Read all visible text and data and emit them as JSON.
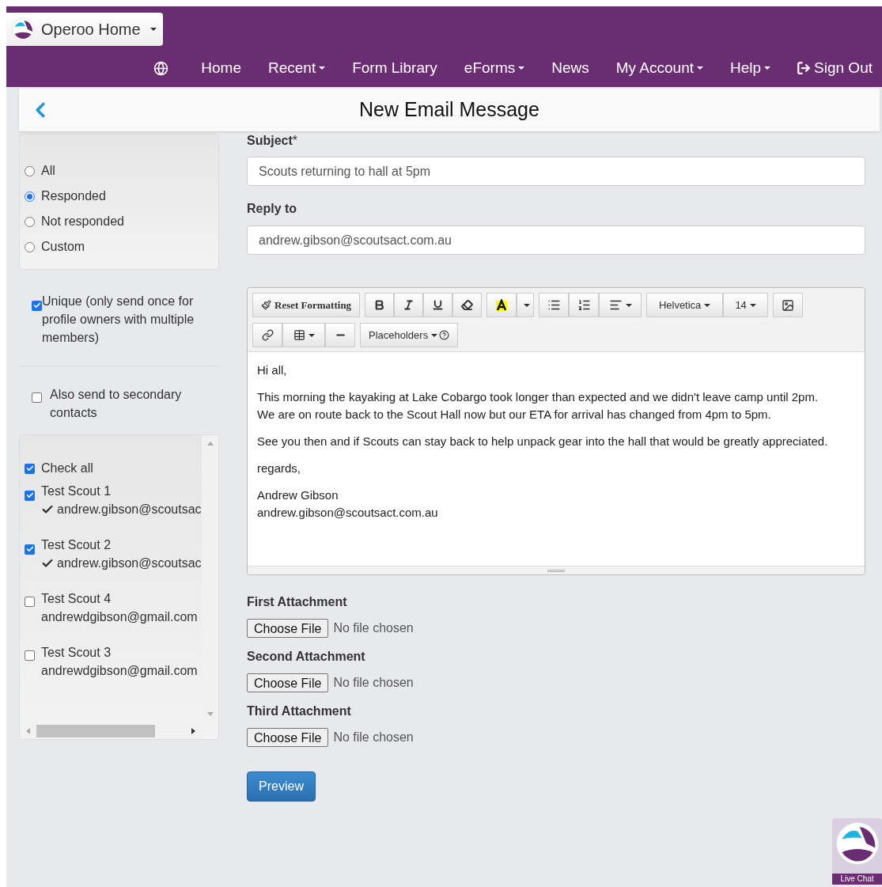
{
  "nav": {
    "brand": "Operoo Home",
    "items": [
      {
        "label": "Home",
        "dropdown": false
      },
      {
        "label": "Recent",
        "dropdown": true
      },
      {
        "label": "Form Library",
        "dropdown": false
      },
      {
        "label": "eForms",
        "dropdown": true
      },
      {
        "label": "News",
        "dropdown": false
      },
      {
        "label": "My Account",
        "dropdown": true
      },
      {
        "label": "Help",
        "dropdown": true
      }
    ],
    "sign_out": "Sign Out"
  },
  "header": {
    "title": "New Email Message"
  },
  "filter": [
    {
      "label": "All",
      "selected": false
    },
    {
      "label": "Responded",
      "selected": true
    },
    {
      "label": "Not responded",
      "selected": false
    },
    {
      "label": "Custom",
      "selected": false
    }
  ],
  "unique": {
    "label": "Unique (only send once for profile owners with multiple members)",
    "checked": true
  },
  "secondary": {
    "label": "Also send to secondary contacts",
    "checked": false
  },
  "recipients": {
    "check_all": {
      "label": "Check all",
      "checked": true
    },
    "items": [
      {
        "name": "Test Scout 1",
        "email": "andrew.gibson@scoutsac",
        "checked": true,
        "verified": true
      },
      {
        "name": "Test Scout 2",
        "email": "andrew.gibson@scoutsac",
        "checked": true,
        "verified": true
      },
      {
        "name": "Test Scout 4",
        "email": "andrewdgibson@gmail.com",
        "checked": false,
        "verified": false
      },
      {
        "name": "Test Scout 3",
        "email": "andrewdgibson@gmail.com",
        "checked": false,
        "verified": false
      }
    ]
  },
  "subject": {
    "label": "Subject",
    "required": "*",
    "value": "Scouts returning to hall at 5pm"
  },
  "reply_to": {
    "label": "Reply to",
    "value": "andrew.gibson@scoutsact.com.au"
  },
  "toolbar": {
    "reset": "Reset Formatting",
    "font": "Helvetica",
    "size": "14",
    "placeholders": "Placeholders"
  },
  "body": [
    [
      "Hi all,"
    ],
    [
      "This morning the kayaking at Lake Cobargo took longer than expected and we didn't leave camp until 2pm.",
      "We are on route back to the Scout Hall now but our ETA for arrival has changed from 4pm to 5pm."
    ],
    [
      "See you then and if Scouts can stay back to help unpack gear into the hall that would be greatly appreciated."
    ],
    [
      "regards,"
    ],
    [
      "Andrew Gibson",
      "andrew.gibson@scoutsact.com.au"
    ]
  ],
  "attachments": [
    {
      "label": "First Attachment",
      "button": "Choose File",
      "status": "No file chosen"
    },
    {
      "label": "Second Attachment",
      "button": "Choose File",
      "status": "No file chosen"
    },
    {
      "label": "Third Attachment",
      "button": "Choose File",
      "status": "No file chosen"
    }
  ],
  "preview": "Preview",
  "live_chat": "Live Chat"
}
